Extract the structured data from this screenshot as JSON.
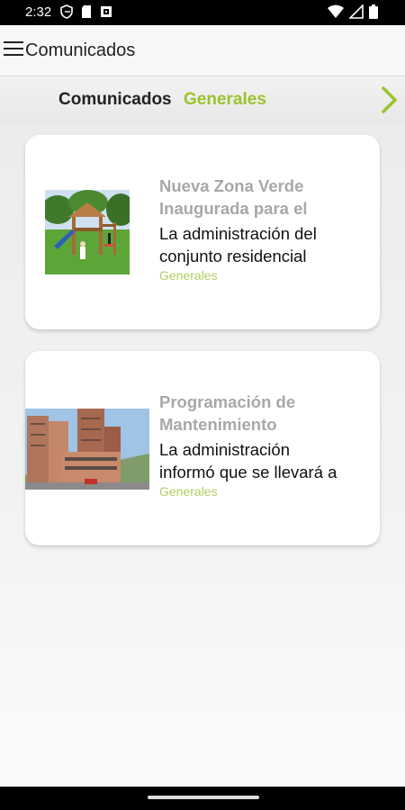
{
  "status": {
    "time": "2:32"
  },
  "app_bar": {
    "title": "Comunicados"
  },
  "tabs": {
    "main": "Comunicados",
    "sub": "Generales"
  },
  "cards": [
    {
      "title_line1": "Nueva Zona Verde",
      "title_line2": "Inaugurada para el",
      "body_line1": "La administración del",
      "body_line2": "conjunto residencial",
      "category": "Generales"
    },
    {
      "title_line1": "Programación de",
      "title_line2": "Mantenimiento",
      "body_line1": "La administración",
      "body_line2": "informó que se llevará a",
      "category": "Generales"
    }
  ],
  "colors": {
    "accent": "#9dc32b",
    "category": "#b5cd66",
    "title_gray": "#a8a8a8"
  }
}
